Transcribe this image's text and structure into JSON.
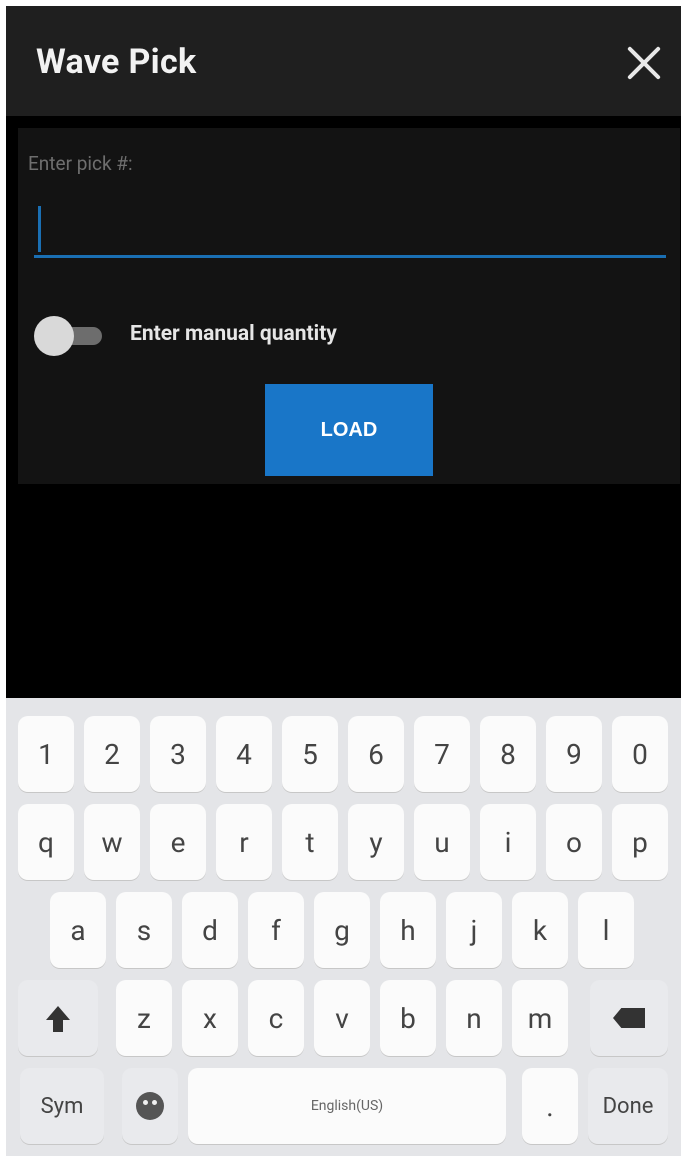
{
  "titlebar": {
    "title": "Wave Pick",
    "close_icon": "close-icon"
  },
  "form": {
    "label": "Enter pick #:",
    "input_value": "",
    "toggle_label": "Enter manual quantity",
    "toggle_state": "off",
    "load_label": "LOAD"
  },
  "colors": {
    "accent": "#1976c8",
    "title_bar": "#1f1f1f",
    "panel": "#131313",
    "background": "#000000",
    "keyboard": "#e4e5e8"
  },
  "keyboard": {
    "row_numbers": [
      "1",
      "2",
      "3",
      "4",
      "5",
      "6",
      "7",
      "8",
      "9",
      "0"
    ],
    "row_top": [
      "q",
      "w",
      "e",
      "r",
      "t",
      "y",
      "u",
      "i",
      "o",
      "p"
    ],
    "row_mid": [
      "a",
      "s",
      "d",
      "f",
      "g",
      "h",
      "j",
      "k",
      "l"
    ],
    "row_bottom": [
      "z",
      "x",
      "c",
      "v",
      "b",
      "n",
      "m"
    ],
    "sym_label": "Sym",
    "space_label": "English(US)",
    "period_label": ".",
    "done_label": "Done",
    "shift_icon": "shift-icon",
    "backspace_icon": "backspace-icon",
    "emoji_icon": "emoji-icon"
  }
}
